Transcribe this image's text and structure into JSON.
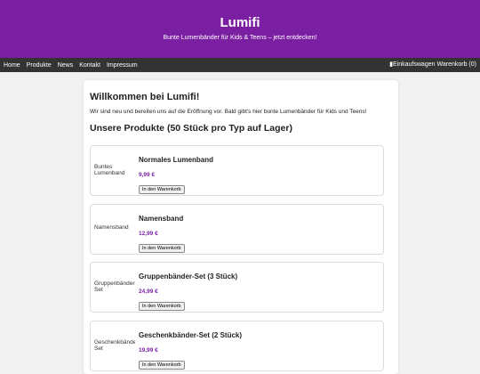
{
  "header": {
    "title": "Lumifi",
    "tagline": "Bunte Lumenbänder für Kids & Teens – jetzt entdecken!"
  },
  "nav": {
    "items": [
      "Home",
      "Produkte",
      "News",
      "Kontakt",
      "Impressum"
    ],
    "cart_img_alt": "Einkaufswagen",
    "cart_label": "Warenkorb (0)"
  },
  "main": {
    "welcome_title": "Willkommen bei Lumifi!",
    "welcome_text": "Wir sind neu und bereiten uns auf die Eröffnung vor. Bald gibt's hier bunte Lumenbänder für Kids und Teens!",
    "products_title": "Unsere Produkte (50 Stück pro Typ auf Lager)",
    "add_button_label": "In den Warenkorb",
    "products": [
      {
        "img_alt": "Buntes Lumenband",
        "name": "Normales Lumenband",
        "price": "9,99 €"
      },
      {
        "img_alt": "Namensband",
        "name": "Namensband",
        "price": "12,99 €"
      },
      {
        "img_alt": "Gruppenbänder-Set",
        "name": "Gruppenbänder-Set (3 Stück)",
        "price": "24,99 €"
      },
      {
        "img_alt": "Geschenkbänder-Set",
        "name": "Geschenkbänder-Set (2 Stück)",
        "price": "19,99 €"
      }
    ]
  }
}
